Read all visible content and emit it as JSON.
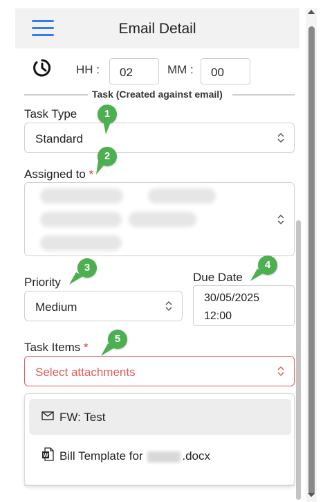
{
  "header": {
    "title": "Email Detail"
  },
  "time": {
    "hh_label": "HH :",
    "hh_value": "02",
    "mm_label": "MM :",
    "mm_value": "00"
  },
  "section": {
    "title": "Task (Created against email)"
  },
  "task_type": {
    "label": "Task Type",
    "value": "Standard"
  },
  "assigned_to": {
    "label": "Assigned to",
    "required_mark": "*",
    "chips": [
      "Andrew Lennon",
      "Accounts",
      "Due To Work",
      "Sea Geo",
      "Debra Breaks"
    ]
  },
  "priority": {
    "label": "Priority",
    "value": "Medium"
  },
  "due_date": {
    "label": "Due Date",
    "date": "30/05/2025",
    "time": "12:00"
  },
  "task_items": {
    "label": "Task Items",
    "required_mark": "*",
    "placeholder": "Select attachments",
    "options": [
      {
        "icon": "email-icon",
        "label": "FW: Test"
      },
      {
        "icon": "word-document-icon",
        "label_prefix": "Bill Template for",
        "label_suffix": ".docx"
      }
    ]
  },
  "badges": [
    "1",
    "2",
    "3",
    "4",
    "5"
  ],
  "colors": {
    "accent": "#2f80ed",
    "badge": "#4caf50",
    "required": "#e03b3b",
    "invalid_border": "#e05a5a"
  }
}
